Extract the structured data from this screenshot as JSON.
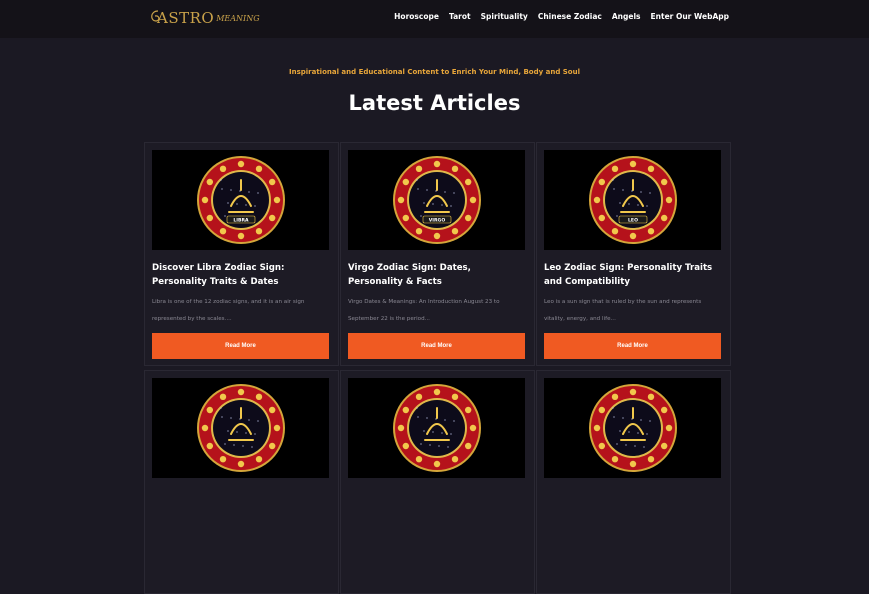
{
  "header": {
    "logo_text": "ASTRO",
    "logo_subtext": "MEANING",
    "nav": [
      {
        "label": "Horoscope"
      },
      {
        "label": "Tarot"
      },
      {
        "label": "Spirituality"
      },
      {
        "label": "Chinese Zodiac"
      },
      {
        "label": "Angels"
      },
      {
        "label": "Enter Our WebApp"
      }
    ]
  },
  "tagline": "Inspirational and Educational Content to Enrich Your Mind, Body and Soul",
  "page_title": "Latest Articles",
  "articles": [
    {
      "title": "Discover Libra Zodiac Sign: Personality Traits & Dates",
      "excerpt": "Libra is one of the 12 zodiac signs, and it is an air sign represented by the scales....",
      "button": "Read More",
      "badge": "LIBRA",
      "sign": "libra"
    },
    {
      "title": "Virgo Zodiac Sign: Dates, Personality & Facts",
      "excerpt": "Virgo Dates & Meanings: An Introduction August 23 to September 22 is the period...",
      "button": "Read More",
      "badge": "VIRGO",
      "sign": "virgo"
    },
    {
      "title": "Leo Zodiac Sign: Personality Traits and Compatibility",
      "excerpt": "Leo is a sun sign that is ruled by the sun and represents vitality, energy, and life...",
      "button": "Read More",
      "badge": "LEO",
      "sign": "leo"
    },
    {
      "title": "",
      "excerpt": "",
      "button": "",
      "badge": "",
      "sign": "scorpio"
    },
    {
      "title": "",
      "excerpt": "",
      "button": "",
      "badge": "",
      "sign": "aries"
    },
    {
      "title": "",
      "excerpt": "",
      "button": "",
      "badge": "",
      "sign": "gemini"
    }
  ],
  "colors": {
    "background": "#1b1923",
    "header": "#141218",
    "accent_gold": "#c9a24a",
    "tagline": "#e8a63a",
    "button": "#f05a22",
    "medallion_red": "#b5121b"
  }
}
